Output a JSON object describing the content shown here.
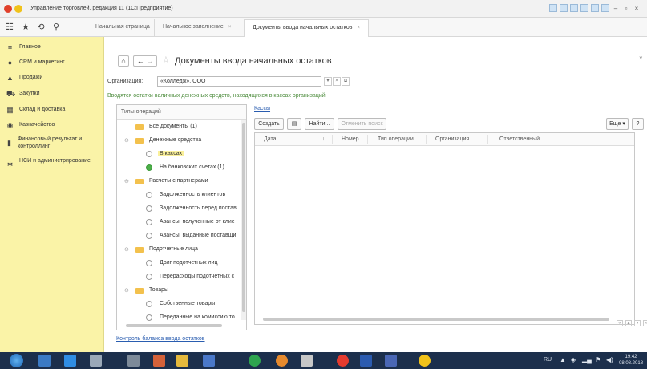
{
  "window": {
    "title": "Управление торговлей, редакция 11 (1С:Предприятие)"
  },
  "tabs": [
    {
      "label": "Начальная страница"
    },
    {
      "label": "Начальное заполнение"
    },
    {
      "label": "Документы ввода начальных остатков"
    }
  ],
  "sidebar": {
    "items": [
      {
        "label": "Главное",
        "icon": "menu-icon"
      },
      {
        "label": "CRM и маркетинг",
        "icon": "crm-icon"
      },
      {
        "label": "Продажи",
        "icon": "sales-icon"
      },
      {
        "label": "Закупки",
        "icon": "cart-icon"
      },
      {
        "label": "Склад и доставка",
        "icon": "warehouse-icon"
      },
      {
        "label": "Казначейство",
        "icon": "treasury-icon"
      },
      {
        "label": "Финансовый результат и контроллинг",
        "icon": "chart-icon"
      },
      {
        "label": "НСИ и администрирование",
        "icon": "gear-icon"
      }
    ]
  },
  "page": {
    "title": "Документы ввода начальных остатков",
    "org_label": "Организация:",
    "org_value": "«Колледж», ООО",
    "hint": "Вводятся остатки наличных денежных средств, находящихся в кассах организаций"
  },
  "tree": {
    "header": "Типы операций",
    "rows": [
      {
        "label": "Все документы (1)",
        "kind": "folder"
      },
      {
        "label": "Денежные средства",
        "kind": "group"
      },
      {
        "label": "В кассах",
        "kind": "radio",
        "selected": true
      },
      {
        "label": "На банковских счетах (1)",
        "kind": "radio-on"
      },
      {
        "label": "Расчеты с партнерами",
        "kind": "group"
      },
      {
        "label": "Задолженность клиентов",
        "kind": "radio"
      },
      {
        "label": "Задолженность перед постав",
        "kind": "radio"
      },
      {
        "label": "Авансы, полученные от клие",
        "kind": "radio"
      },
      {
        "label": "Авансы, выданные поставщи",
        "kind": "radio"
      },
      {
        "label": "Подотчетные лица",
        "kind": "group"
      },
      {
        "label": "Долг подотчетных лиц",
        "kind": "radio"
      },
      {
        "label": "Перерасходы подотчетных с",
        "kind": "radio"
      },
      {
        "label": "Товары",
        "kind": "group"
      },
      {
        "label": "Собственные товары",
        "kind": "radio"
      },
      {
        "label": "Переданные на комиссию то",
        "kind": "radio"
      }
    ]
  },
  "list": {
    "section_link": "Кассы",
    "toolbar": {
      "create": "Создать",
      "find": "Найти...",
      "cancel_search": "Отменить поиск",
      "more": "Еще",
      "help": "?"
    },
    "columns": [
      "Дата",
      "↓",
      "Номер",
      "Тип операции",
      "Организация",
      "Ответственный"
    ]
  },
  "footer": {
    "link": "Контроль баланса ввода остатков"
  },
  "taskbar": {
    "lang": "RU",
    "time": "19:42",
    "date": "08.08.2018"
  }
}
